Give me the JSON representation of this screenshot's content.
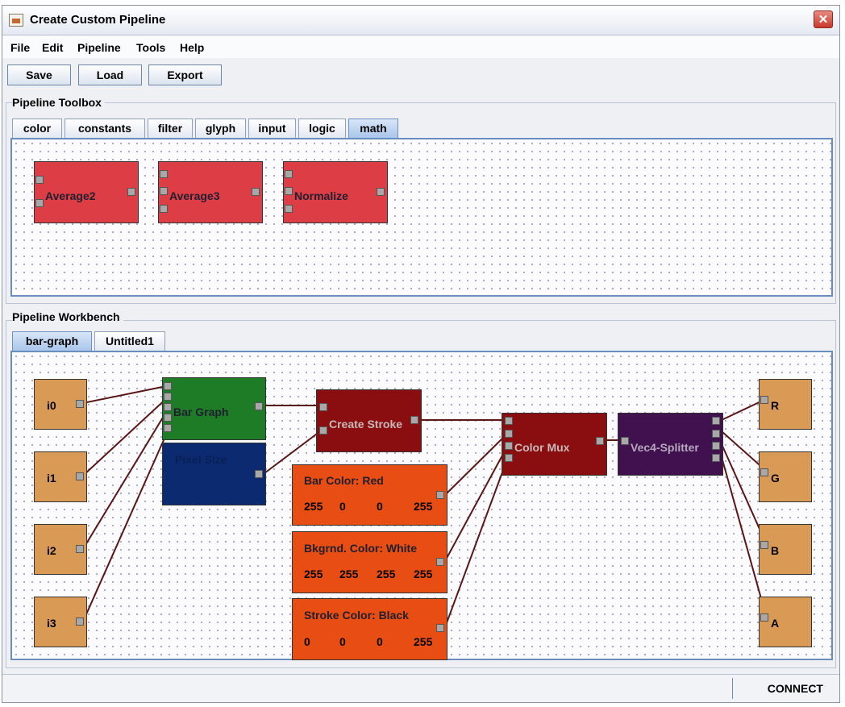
{
  "window": {
    "title": "Create Custom Pipeline",
    "close_symbol": "✕"
  },
  "menu": {
    "items": [
      "File",
      "Edit",
      "Pipeline",
      "Tools",
      "Help"
    ]
  },
  "toolbar": {
    "save_label": "Save",
    "load_label": "Load",
    "export_label": "Export"
  },
  "toolbox": {
    "title": "Pipeline Toolbox",
    "tabs": [
      "color",
      "constants",
      "filter",
      "glyph",
      "input",
      "logic",
      "math"
    ],
    "active_tab": "math",
    "nodes": [
      {
        "label": "Average2",
        "color": "#dd3d45"
      },
      {
        "label": "Average3",
        "color": "#dd3d45"
      },
      {
        "label": "Normalize",
        "color": "#dd3d45"
      }
    ]
  },
  "workbench": {
    "title": "Pipeline Workbench",
    "tabs": [
      "bar-graph",
      "Untitled1"
    ],
    "active_tab": "bar-graph",
    "inputs": [
      "i0",
      "i1",
      "i2",
      "i3"
    ],
    "bar_graph": "Bar Graph",
    "pixel_size": "Pixel Size",
    "create_stroke": "Create Stroke",
    "color_mux": "Color Mux",
    "splitter": "Vec4-Splitter",
    "outputs": [
      "R",
      "G",
      "B",
      "A"
    ],
    "color_constants": [
      {
        "label": "Bar Color: Red",
        "values": [
          "255",
          "0",
          "0",
          "255"
        ]
      },
      {
        "label": "Bkgrnd. Color: White",
        "values": [
          "255",
          "255",
          "255",
          "255"
        ]
      },
      {
        "label": "Stroke Color: Black",
        "values": [
          "0",
          "0",
          "0",
          "255"
        ]
      }
    ]
  },
  "status": {
    "text": "CONNECT"
  },
  "colors": {
    "math_node": "#dd3d45",
    "input_node": "#d99a56",
    "bar_graph_node": "#1e7b26",
    "pixel_size_node": "#0c2a70",
    "stroke_mux_node": "#8a0e10",
    "splitter_node": "#40114e",
    "constant_node": "#e84d13",
    "wire": "#5a1515"
  }
}
